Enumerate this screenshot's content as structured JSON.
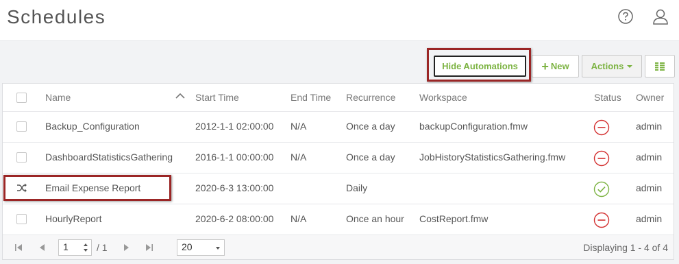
{
  "header": {
    "title": "Schedules",
    "help_icon": "help-circle-icon",
    "user_icon": "user-icon"
  },
  "toolbar": {
    "hide_automations_label": "Hide Automations",
    "new_label": "New",
    "actions_label": "Actions",
    "columns_icon": "columns-icon",
    "accent_color": "#7cb342"
  },
  "table": {
    "columns": [
      "Name",
      "Start Time",
      "End Time",
      "Recurrence",
      "Workspace",
      "Status",
      "Owner"
    ],
    "rows": [
      {
        "name": "Backup_Configuration",
        "start": "2012-1-1 02:00:00",
        "end": "N/A",
        "recurrence": "Once a day",
        "workspace": "backupConfiguration.fmw",
        "status": "disabled",
        "owner": "admin",
        "type": "checkbox"
      },
      {
        "name": "DashboardStatisticsGathering",
        "start": "2016-1-1 00:00:00",
        "end": "N/A",
        "recurrence": "Once a day",
        "workspace": "JobHistoryStatisticsGathering.fmw",
        "status": "disabled",
        "owner": "admin",
        "type": "checkbox"
      },
      {
        "name": "Email Expense Report",
        "start": "2020-6-3 13:00:00",
        "end": "",
        "recurrence": "Daily",
        "workspace": "",
        "status": "enabled",
        "owner": "admin",
        "type": "automation"
      },
      {
        "name": "HourlyReport",
        "start": "2020-6-2 08:00:00",
        "end": "N/A",
        "recurrence": "Once an hour",
        "workspace": "CostReport.fmw",
        "status": "disabled",
        "owner": "admin",
        "type": "checkbox"
      }
    ],
    "status_colors": {
      "disabled": "#d32f2f",
      "enabled": "#7cb342"
    }
  },
  "pagination": {
    "page": "1",
    "total_pages": "/ 1",
    "page_size": "20",
    "display_text": "Displaying 1 - 4 of 4"
  }
}
